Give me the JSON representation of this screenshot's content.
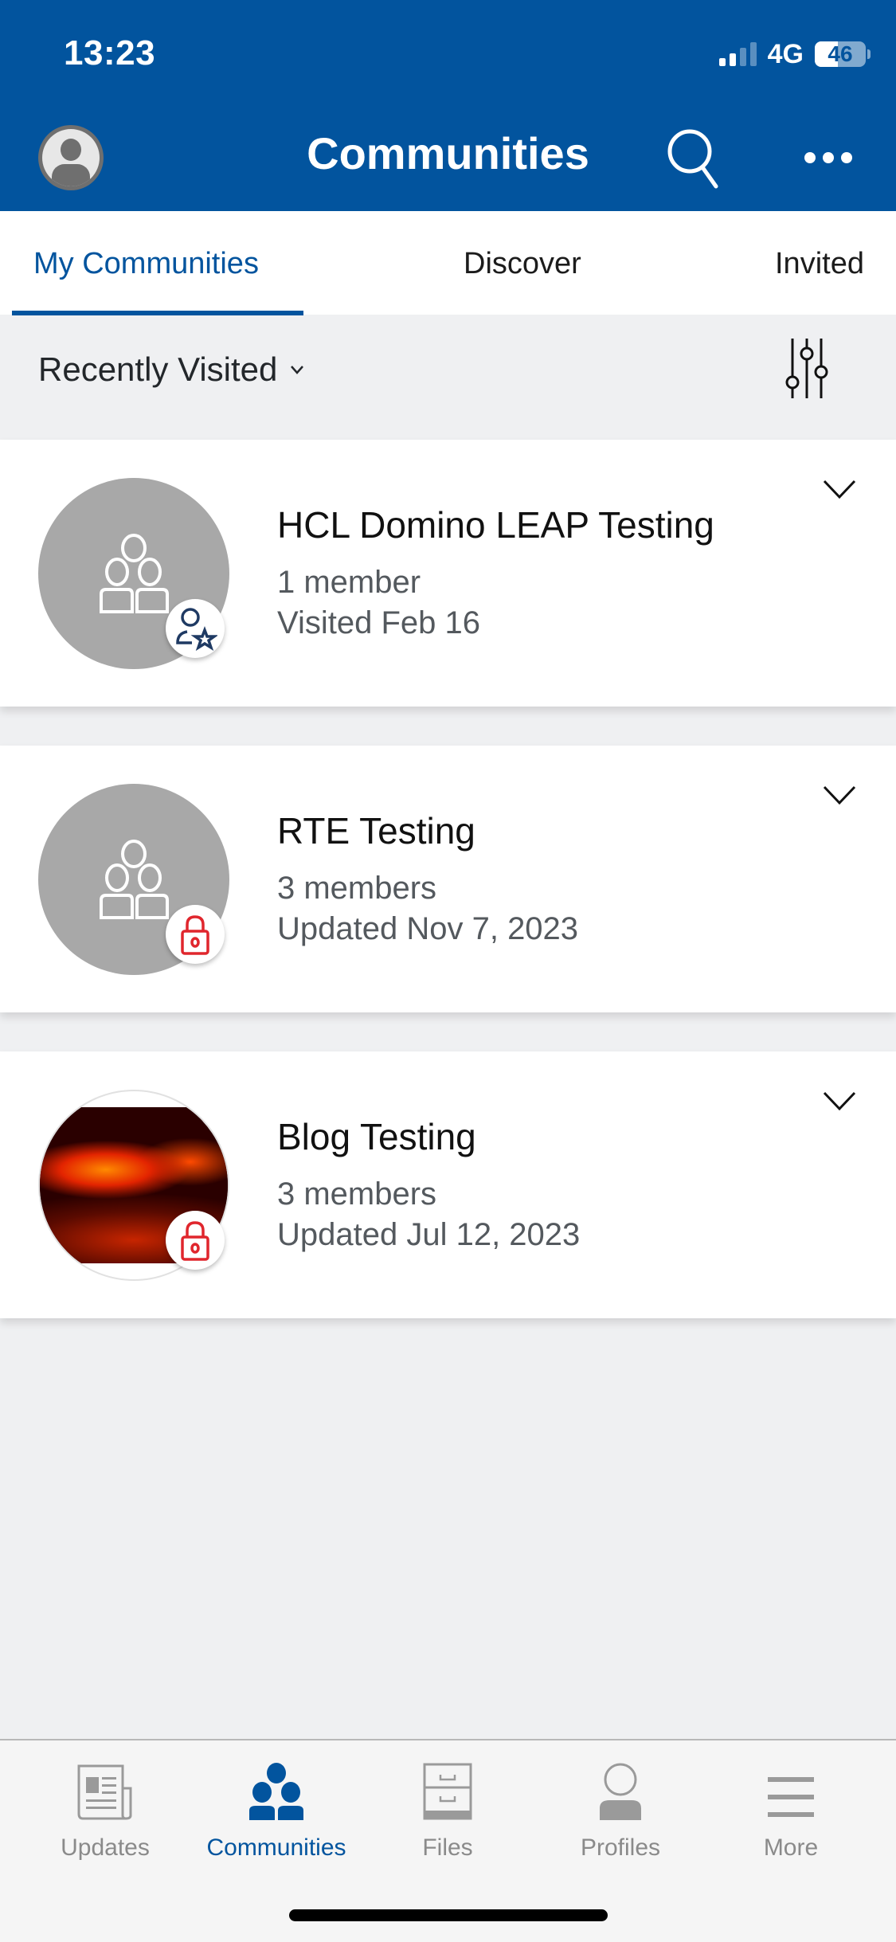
{
  "status_bar": {
    "time": "13:23",
    "network": "4G",
    "signal_bars_active": 2,
    "signal_bars_total": 4,
    "battery_percent": 46
  },
  "header": {
    "title": "Communities",
    "avatar_icon": "user-avatar-icon",
    "search_icon": "search-icon",
    "more_icon": "more-horizontal-icon"
  },
  "tabs": [
    {
      "label": "My Communities",
      "active": true
    },
    {
      "label": "Discover",
      "active": false
    },
    {
      "label": "Invited",
      "active": false
    }
  ],
  "filter": {
    "sort_label": "Recently Visited",
    "sort_icon": "chevron-down-icon",
    "filter_icon": "sliders-icon"
  },
  "communities": [
    {
      "name": "HCL Domino LEAP Testing",
      "members": "1 member",
      "date": "Visited Feb 16",
      "avatar": "group-placeholder",
      "badge": "owner-star-icon"
    },
    {
      "name": "RTE Testing",
      "members": "3 members",
      "date": "Updated Nov 7, 2023",
      "avatar": "group-placeholder",
      "badge": "lock-icon"
    },
    {
      "name": "Blog Testing",
      "members": "3 members",
      "date": "Updated Jul 12, 2023",
      "avatar": "fire-photo",
      "badge": "lock-icon"
    }
  ],
  "bottom_nav": [
    {
      "label": "Updates",
      "icon": "newspaper-icon",
      "active": false
    },
    {
      "label": "Communities",
      "icon": "communities-icon",
      "active": true
    },
    {
      "label": "Files",
      "icon": "file-cabinet-icon",
      "active": false
    },
    {
      "label": "Profiles",
      "icon": "person-icon",
      "active": false
    },
    {
      "label": "More",
      "icon": "hamburger-menu-icon",
      "active": false
    }
  ],
  "colors": {
    "brand_blue": "#02549e",
    "lock_red": "#e0262d",
    "star_navy": "#1f3a63",
    "inactive_gray": "#8a8a8a"
  }
}
